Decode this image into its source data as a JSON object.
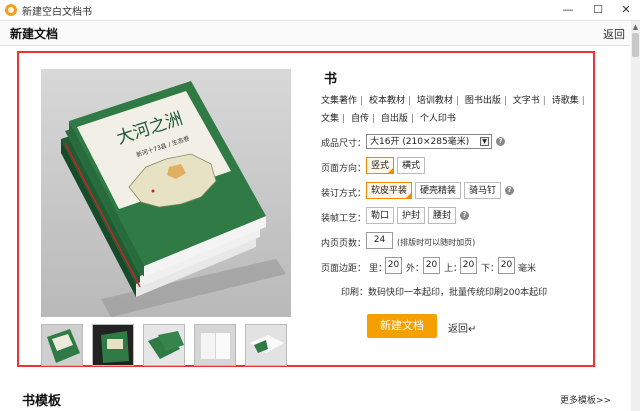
{
  "window": {
    "title": "新建空白文档书",
    "minimize": "—",
    "maximize": "☐",
    "close": "✕"
  },
  "header": {
    "title": "新建文档",
    "back": "返回"
  },
  "book": {
    "section_title": "书",
    "categories": [
      "文集著作",
      "校本教材",
      "培训教材",
      "图书出版",
      "文字书",
      "诗歌集",
      "文集",
      "自传",
      "自出版",
      "个人印书"
    ],
    "cover_title": "大河之洲",
    "cover_subtitle": "新河十73县 / 生态卷"
  },
  "form": {
    "size_label": "成品尺寸：",
    "size_value": "大16开 (210×285毫米)",
    "orientation_label": "页面方向：",
    "orientation_options": [
      "竖式",
      "横式"
    ],
    "binding_label": "装订方式：",
    "binding_options": [
      "软皮平装",
      "硬壳精装",
      "骑马钉"
    ],
    "craft_label": "装帧工艺：",
    "craft_options": [
      "勒口",
      "护封",
      "腰封"
    ],
    "pages_label": "内页页数：",
    "pages_value": "24",
    "pages_note": "(排版时可以随时加页)",
    "margin_label": "页面边距：",
    "margin_inner_label": "里：",
    "margin_inner": "20",
    "margin_outer_label": "外：",
    "margin_outer": "20",
    "margin_top_label": "上：",
    "margin_top": "20",
    "margin_bottom_label": "下：",
    "margin_bottom": "20",
    "margin_unit": "毫米",
    "print_note": "印刷：数码快印一本起印，批量传统印刷200本起印",
    "create_button": "新建文档",
    "back_link": "返回↵"
  },
  "templates": {
    "title": "书模板",
    "more": "更多模板>>"
  },
  "colors": {
    "accent": "#f5a000",
    "panel_border": "#e33333",
    "selected_border": "#f08a00",
    "cover_green": "#2f7a45"
  },
  "icons": [
    "app-logo-icon",
    "help-icon",
    "dropdown-arrow-icon",
    "scroll-up-icon"
  ]
}
